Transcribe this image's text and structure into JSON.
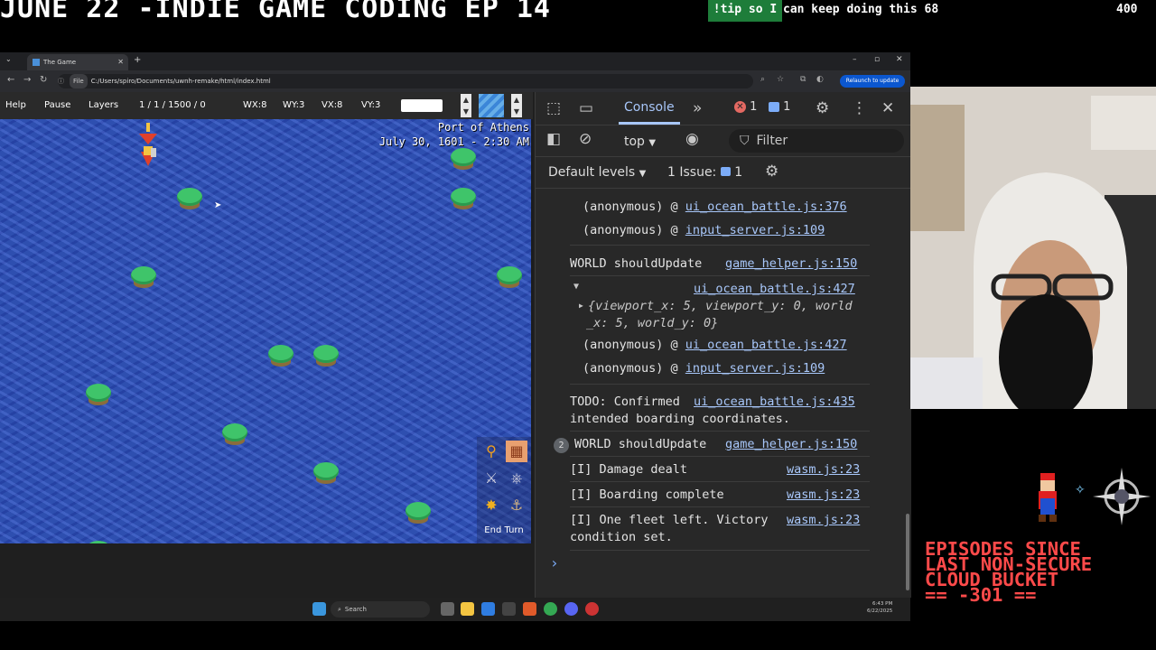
{
  "overlay": {
    "stream_title": "JUNE 22 -INDIE GAME CODING EP 14",
    "tip_command": "!tip so I",
    "tip_rest": "can keep doing this 68",
    "tip_count": "400",
    "episodes_line1": "EPISODES SINCE",
    "episodes_line2": "LAST NON-SECURE",
    "episodes_line3": "CLOUD BUCKET",
    "episodes_line4": "== -301 =="
  },
  "browser": {
    "tab_title": "The Game",
    "url": "C:/Users/spiro/Documents/uwnh-remake/html/index.html",
    "url_scheme": "File",
    "relaunch_label": "Relaunch to update"
  },
  "game": {
    "menu": {
      "help": "Help",
      "pause": "Pause",
      "layers": "Layers",
      "counter": "1 / 1 / 1500 / 0",
      "wx": "WX:8",
      "wy": "WY:3",
      "vx": "VX:8",
      "vy": "VY:3"
    },
    "port_name": "Port of Athens",
    "date": "July 30, 1601 - 2:30 AM",
    "end_turn": "End Turn",
    "islands": [
      {
        "x": 3,
        "y": 1
      },
      {
        "x": 2,
        "y": 3
      },
      {
        "x": 10,
        "y": 3
      },
      {
        "x": 5,
        "y": 5
      },
      {
        "x": 6,
        "y": 5
      },
      {
        "x": 1,
        "y": 6
      },
      {
        "x": 4,
        "y": 7
      },
      {
        "x": 6,
        "y": 8
      },
      {
        "x": 8,
        "y": 9
      },
      {
        "x": 1,
        "y": 10
      },
      {
        "x": 2,
        "y": 11
      },
      {
        "x": 9,
        "y": 1
      },
      {
        "x": 9,
        "y": 0
      }
    ]
  },
  "devtools": {
    "console_tab": "Console",
    "error_count": "1",
    "issue_count": "1",
    "context": "top",
    "filter_placeholder": "Filter",
    "default_levels": "Default levels",
    "issues_label": "1 Issue:",
    "issues_num": "1",
    "log": {
      "l1_text": "(anonymous) @ ",
      "l1_link": "ui_ocean_battle.js:376",
      "l2_text": "(anonymous) @ ",
      "l2_link": "input_server.js:109",
      "l3_text": "WORLD shouldUpdate",
      "l3_link": "game_helper.js:150",
      "l4_link": "ui_ocean_battle.js:427",
      "l5_obj_a": "{viewport_x: 5, viewport_y: 0, world",
      "l5_obj_b": "_x: 5, world_y: 0}",
      "l6_text": "(anonymous) @ ",
      "l6_link": "ui_ocean_battle.js:427",
      "l7_text": "(anonymous) @ ",
      "l7_link": "input_server.js:109",
      "l8_text": "TODO: Confirmed",
      "l8_link": "ui_ocean_battle.js:435",
      "l8_text2": "intended boarding coordinates.",
      "l9_count": "2",
      "l9_text": "WORLD shouldUpdate",
      "l9_link": "game_helper.js:150",
      "l10_text": "[I] Damage dealt",
      "l10_link": "wasm.js:23",
      "l11_text": "[I] Boarding complete",
      "l11_link": "wasm.js:23",
      "l12_text": "[I] One fleet left. Victory",
      "l12_link": "wasm.js:23",
      "l12_text2": "condition set.",
      "prompt": "›"
    }
  },
  "taskbar": {
    "search": "Search",
    "time": "6:43 PM",
    "date": "6/22/2025"
  }
}
